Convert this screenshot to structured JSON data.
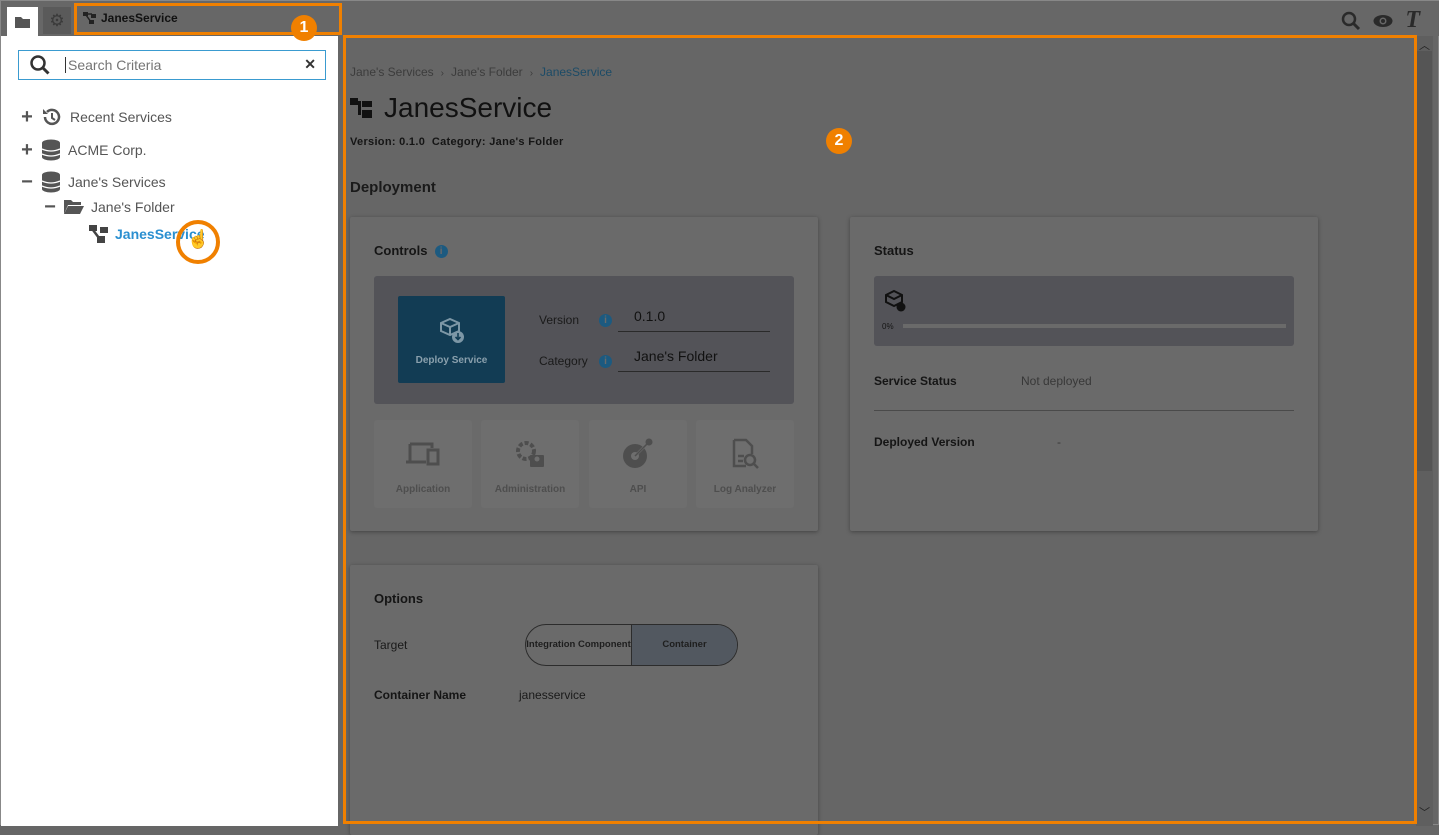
{
  "topbar": {
    "active_tab": "JanesService",
    "tools": [
      "search-icon",
      "eye-icon",
      "text-icon"
    ]
  },
  "sidebar": {
    "search_placeholder": "Search Criteria",
    "tree": [
      {
        "label": "Recent Services",
        "toggle": "+"
      },
      {
        "label": "ACME Corp.",
        "toggle": "+"
      },
      {
        "label": "Jane's Services",
        "toggle": "−"
      },
      {
        "label": "Jane's Folder",
        "toggle": "−"
      },
      {
        "label": "JanesService",
        "selected": true
      }
    ]
  },
  "main": {
    "breadcrumb": [
      "Jane's Services",
      "Jane's Folder",
      "JanesService"
    ],
    "title": "JanesService",
    "meta": "Version: 0.1.0  Category: Jane's Folder",
    "section": "Deployment",
    "controls": {
      "title": "Controls",
      "deploy_label": "Deploy Service",
      "version_label": "Version",
      "version_value": "0.1.0",
      "category_label": "Category",
      "category_value": "Jane's Folder",
      "tiles": [
        "Application",
        "Administration",
        "API",
        "Log Analyzer"
      ]
    },
    "status": {
      "title": "Status",
      "progress": "0%",
      "progress_value": 0,
      "service_status_label": "Service Status",
      "service_status_value": "Not deployed",
      "deployed_version_label": "Deployed Version",
      "deployed_version_value": "-"
    },
    "options": {
      "title": "Options",
      "target_label": "Target",
      "target_options": [
        "Integration Component",
        "Container"
      ],
      "target_selected": "Container",
      "container_name_label": "Container Name",
      "container_name_value": "janesservice"
    }
  },
  "annotations": {
    "badge1": "1",
    "badge2": "2",
    "color": "#f08000"
  }
}
